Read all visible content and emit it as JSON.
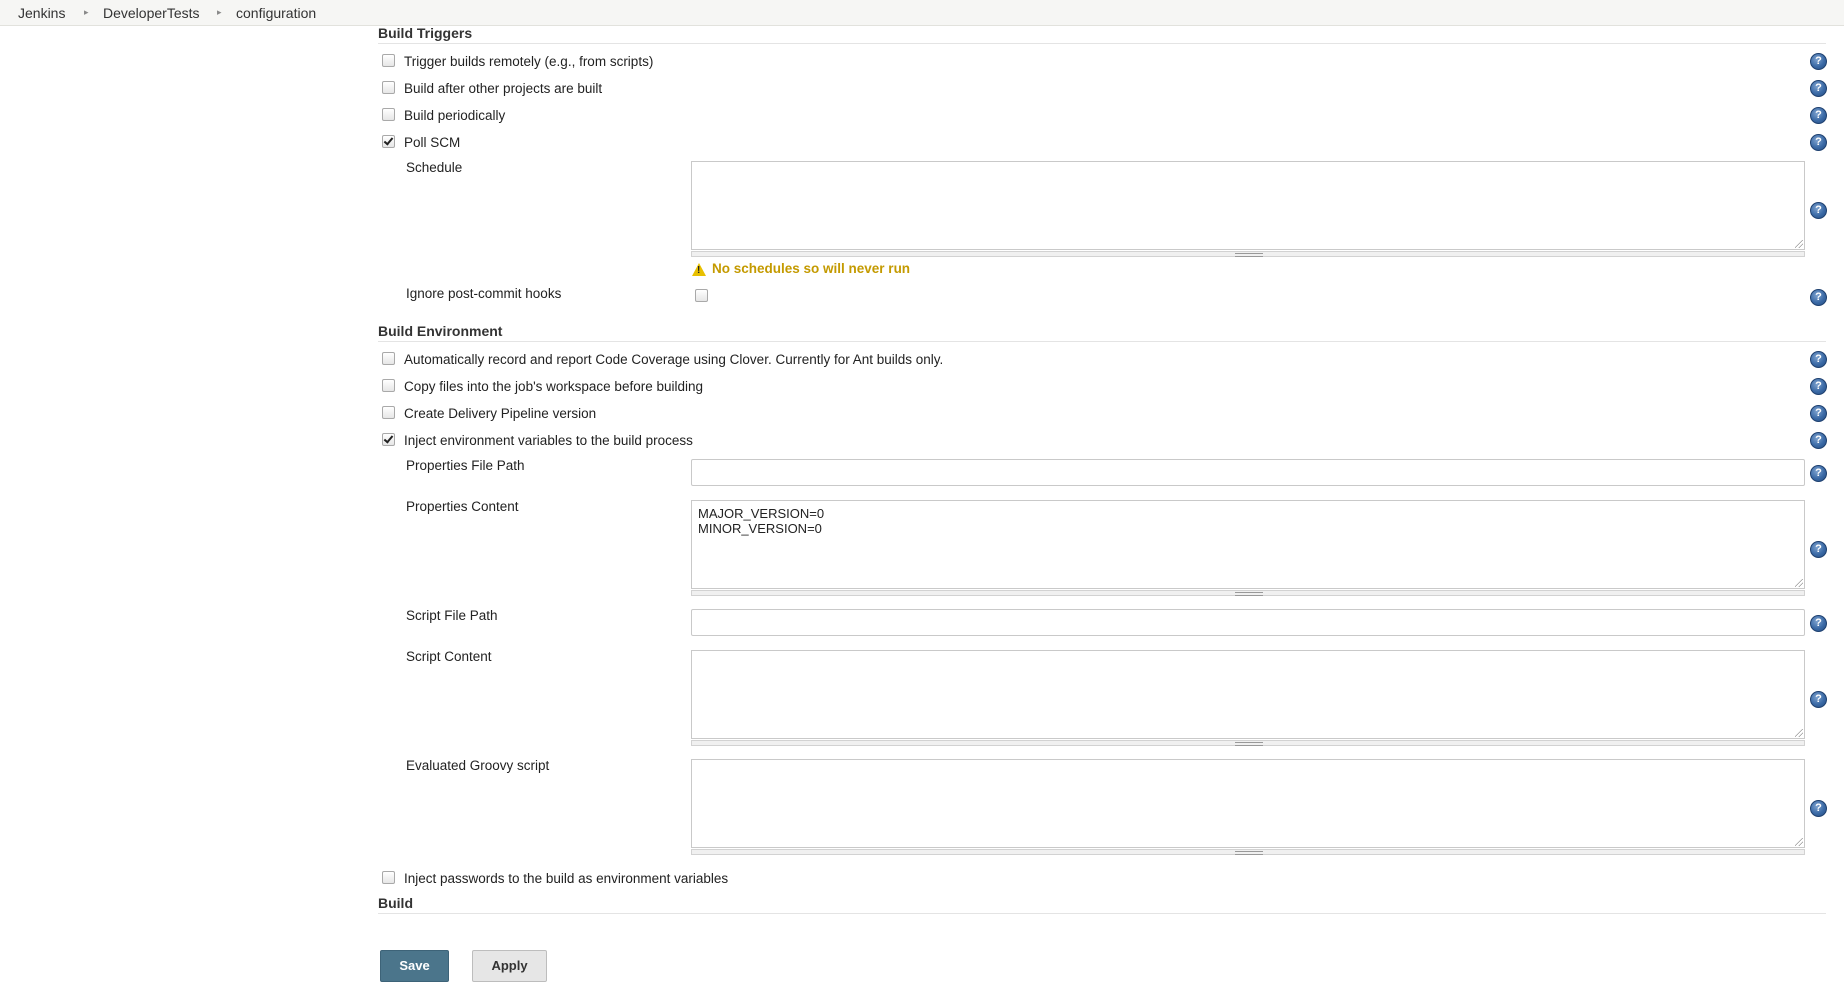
{
  "breadcrumb": {
    "items": [
      "Jenkins",
      "DeveloperTests",
      "configuration"
    ]
  },
  "build_triggers": {
    "title": "Build Triggers",
    "options": [
      {
        "label": "Trigger builds remotely (e.g., from scripts)",
        "checked": false
      },
      {
        "label": "Build after other projects are built",
        "checked": false
      },
      {
        "label": "Build periodically",
        "checked": false
      },
      {
        "label": "Poll SCM",
        "checked": true
      }
    ],
    "schedule_label": "Schedule",
    "schedule_value": "",
    "schedule_warning": "No schedules so will never run",
    "ignore_hooks_label": "Ignore post-commit hooks",
    "ignore_hooks_checked": false
  },
  "build_environment": {
    "title": "Build Environment",
    "options": [
      {
        "label": "Automatically record and report Code Coverage using Clover. Currently for Ant builds only.",
        "checked": false
      },
      {
        "label": "Copy files into the job's workspace before building",
        "checked": false
      },
      {
        "label": "Create Delivery Pipeline version",
        "checked": false
      },
      {
        "label": "Inject environment variables to the build process",
        "checked": true
      }
    ],
    "properties_file_path_label": "Properties File Path",
    "properties_file_path_value": "",
    "properties_content_label": "Properties Content",
    "properties_content_value": "MAJOR_VERSION=0\nMINOR_VERSION=0",
    "script_file_path_label": "Script File Path",
    "script_file_path_value": "",
    "script_content_label": "Script Content",
    "script_content_value": "",
    "groovy_script_label": "Evaluated Groovy script",
    "groovy_script_value": "",
    "inject_passwords_label": "Inject passwords to the build as environment variables",
    "inject_passwords_checked": false
  },
  "build": {
    "title": "Build"
  },
  "buttons": {
    "save_label": "Save",
    "apply_label": "Apply"
  },
  "help_glyph": "?",
  "colors": {
    "save_button": "#4b758b",
    "warning_text": "#c49a00",
    "help_icon": "#3b6aa6"
  }
}
